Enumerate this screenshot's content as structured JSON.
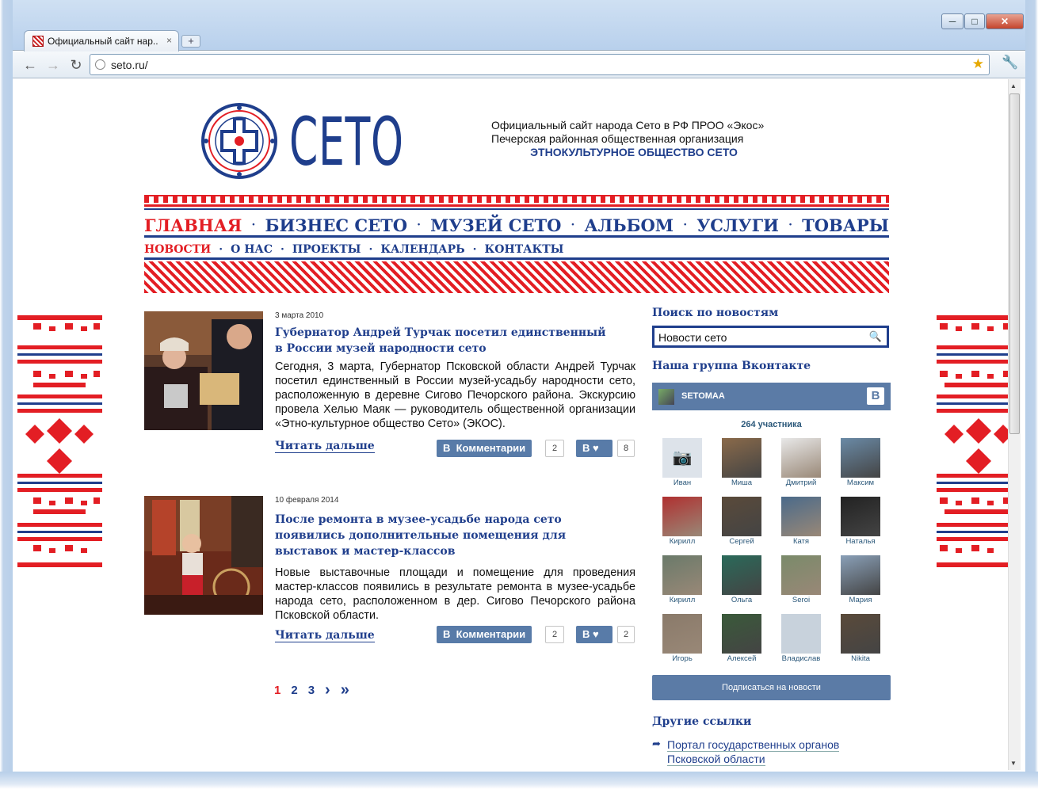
{
  "browser": {
    "tab_title": "Официальный сайт нар...",
    "tab_close": "×",
    "new_tab": "+",
    "minimize": "─",
    "maximize": "□",
    "close": "✕",
    "url": "seto.ru/"
  },
  "header": {
    "logo_text": "СЕТО",
    "info_line1": "Официальный сайт народа Сето в РФ ПРОО «Экос»",
    "info_line2": "Печерская районная общественная организация",
    "info_line3": "ЭТНОКУЛЬТУРНОЕ ОБЩЕСТВО СЕТО"
  },
  "main_menu": [
    "ГЛАВНАЯ",
    "БИЗНЕС СЕТО",
    "МУЗЕЙ СЕТО",
    "АЛЬБОМ",
    "УСЛУГИ",
    "ТОВАРЫ"
  ],
  "sub_menu": [
    "НОВОСТИ",
    "О НАС",
    "ПРОЕКТЫ",
    "КАЛЕНДАРЬ",
    "КОНТАКТЫ"
  ],
  "news": [
    {
      "date": "3 марта 2010",
      "title": "Губернатор Андрей Турчак посетил единственный в России музей народности сето",
      "body": "Сегодня, 3 марта, Губернатор Псковской области Андрей Турчак посетил единственный в России музей-усадьбу народности сето, расположенную в деревне Сигово Печорского района. Экскурсию провела Хелью Маяк — руководитель общественной организации «Этно-культурное общество Сето» (ЭКОС).",
      "read_more": "Читать дальше",
      "comments_label": "Комментарии",
      "comments_count": "2",
      "likes_count": "8"
    },
    {
      "date": "10 февраля 2014",
      "title": "После ремонта в музее-усадьбе народа сето появились дополнительные помещения для выставок и мастер-классов",
      "body": "Новые выставочные площади и помещение для проведения мастер-классов появились в результате ремонта в музее-усадьбе народа сето, расположенном в дер. Сигово Печорского района Псковской области.",
      "read_more": "Читать дальше",
      "comments_label": "Комментарии",
      "comments_count": "2",
      "likes_count": "2"
    }
  ],
  "vk_letter": "В",
  "pagination": [
    "1",
    "2",
    "3",
    "›",
    "»"
  ],
  "sidebar": {
    "search_title": "Поиск по новостям",
    "search_value": "Новости сето",
    "vk_title": "Наша группа Вконтакте",
    "vk_group": "SETOMAA",
    "vk_members": "264 участника",
    "members": [
      "Иван",
      "Миша",
      "Дмитрий",
      "Максим",
      "Кирилл",
      "Сергей",
      "Катя",
      "Наталья",
      "Кирилл",
      "Ольга",
      "Seroi",
      "Мария",
      "Игорь",
      "Алексей",
      "Владислав",
      "Nikita"
    ],
    "subscribe": "Подписаться на новости",
    "links_title": "Другие ссылки",
    "link_portal": "Портал государственных органов Псковской области"
  },
  "colors": {
    "brand_blue": "#1f3e8c",
    "accent_red": "#e31e24",
    "vk_blue": "#5b7ba6"
  }
}
